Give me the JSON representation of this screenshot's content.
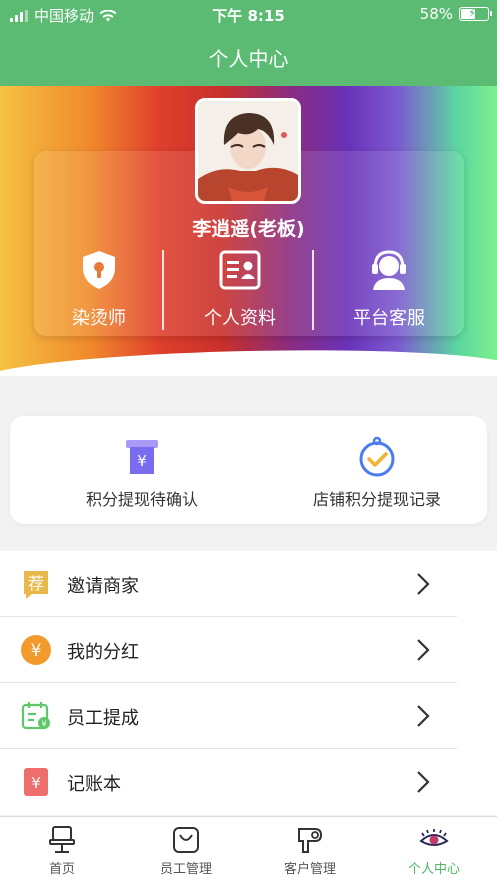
{
  "status_bar": {
    "carrier": "中国移动",
    "time": "下午 8:15",
    "battery": "58%",
    "battery_level": 0.58
  },
  "nav": {
    "title": "个人中心"
  },
  "profile": {
    "name": "李逍遥(老板)",
    "quick_actions": [
      {
        "label": "染烫师",
        "icon": "shield-keyhole-icon"
      },
      {
        "label": "个人资料",
        "icon": "profile-card-icon"
      },
      {
        "label": "平台客服",
        "icon": "customer-service-icon"
      }
    ]
  },
  "withdraw": {
    "items": [
      {
        "label": "积分提现待确认",
        "icon": "yen-box-icon",
        "color": "#7a6cf0"
      },
      {
        "label": "店铺积分提现记录",
        "icon": "check-clock-icon",
        "color": "#4a7cf0"
      }
    ]
  },
  "menu": {
    "items": [
      {
        "label": "邀请商家",
        "icon": "recommend-icon",
        "color": "#e8b84a",
        "glyph": "荐"
      },
      {
        "label": "我的分红",
        "icon": "yen-coin-icon",
        "color": "#f29a2c",
        "glyph": "¥"
      },
      {
        "label": "员工提成",
        "icon": "calendar-coin-icon",
        "color": "#5fc76a"
      },
      {
        "label": "记账本",
        "icon": "ledger-icon",
        "color": "#ee6e6e",
        "glyph": "¥"
      }
    ]
  },
  "tabbar": {
    "items": [
      {
        "label": "首页",
        "icon": "barber-chair-icon",
        "active": false
      },
      {
        "label": "员工管理",
        "icon": "shopping-bag-icon",
        "active": false
      },
      {
        "label": "客户管理",
        "icon": "hair-dryer-icon",
        "active": false
      },
      {
        "label": "个人中心",
        "icon": "eye-lashes-icon",
        "active": true
      }
    ]
  },
  "colors": {
    "brand_green": "#5bbb72",
    "active_tab": "#4fb866"
  }
}
